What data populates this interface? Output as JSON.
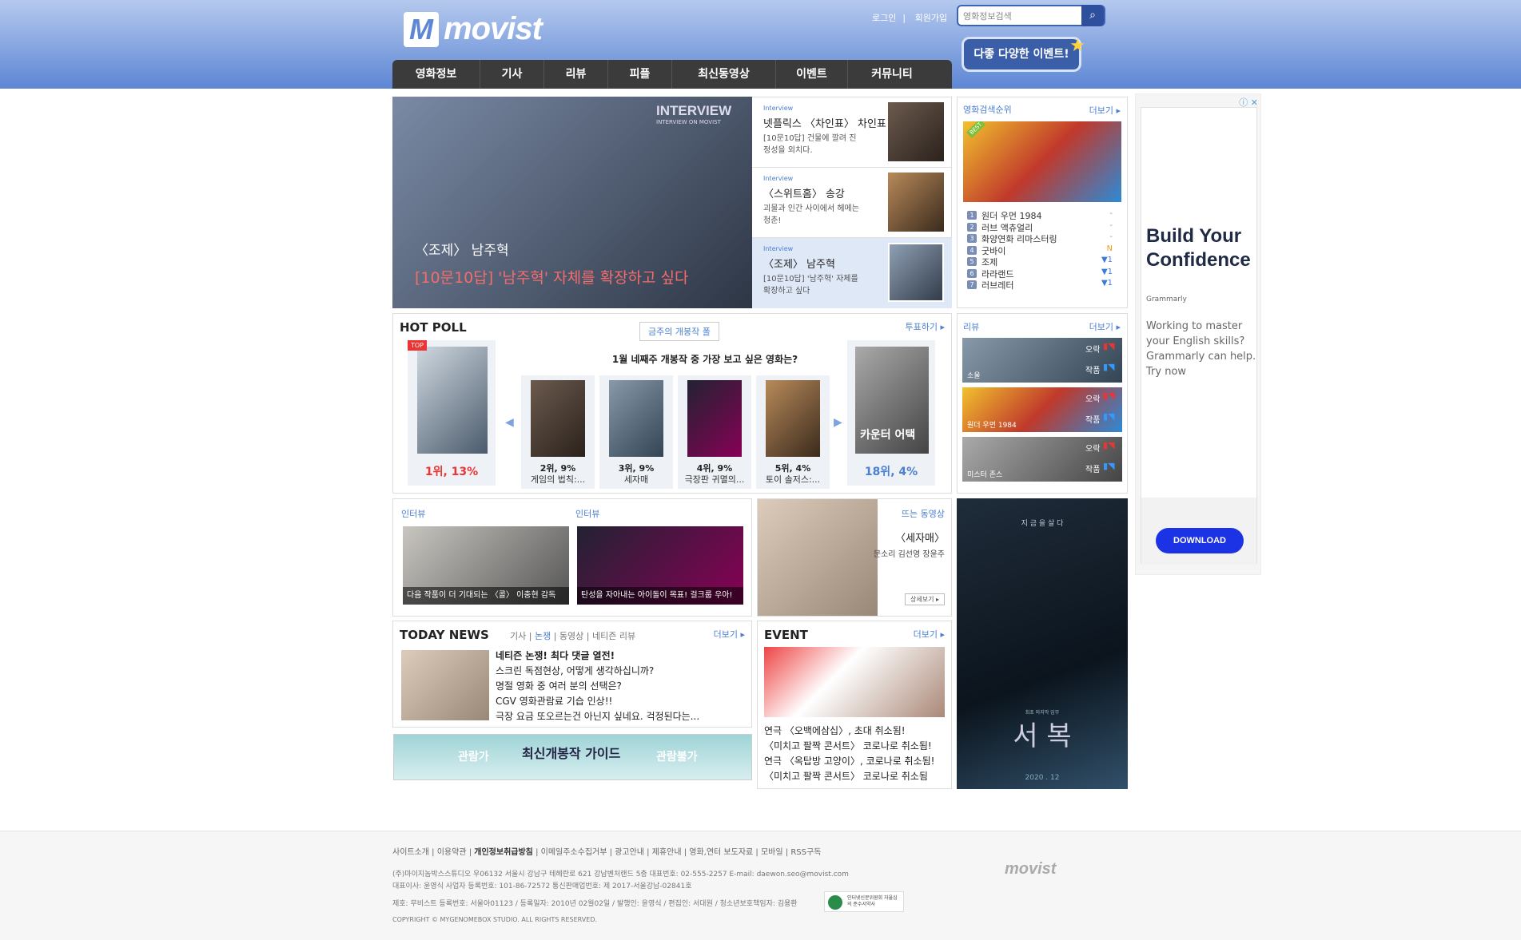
{
  "header": {
    "logo_mark": "M",
    "logo_text": "movist",
    "login": "로그인",
    "signup": "회원가입",
    "search_placeholder": "영화정보검색",
    "event_banner": "다좋 다양한 이벤트!"
  },
  "nav": [
    "영화정보",
    "기사",
    "리뷰",
    "피플",
    "최신동영상",
    "이벤트",
    "커뮤니티"
  ],
  "hero": {
    "badge": "INTERVIEW",
    "badge_sub": "INTERVIEW ON MOVIST",
    "title": "〈조제〉 남주혁",
    "subtitle": "[10문10답] '남주혁' 자체를 확장하고 싶다"
  },
  "interviews": [
    {
      "tag": "Interview",
      "title": "넷플릭스 〈차인표〉 차인표",
      "desc": "[10문10답] 건물에 깔려 진정성을 외치다."
    },
    {
      "tag": "Interview",
      "title": "〈스위트홈〉 송강",
      "desc": "괴물과 인간 사이에서 헤메는 청춘!"
    },
    {
      "tag": "Interview",
      "title": "〈조제〉 남주혁",
      "desc": "[10문10답] '남주혁' 자체를 확장하고 싶다"
    }
  ],
  "ranking": {
    "title": "영화검색순위",
    "more": "더보기",
    "best": "BEST",
    "items": [
      {
        "n": "1",
        "title": "원더 우먼 1984",
        "chg": "-"
      },
      {
        "n": "2",
        "title": "러브 액츄얼리",
        "chg": "-"
      },
      {
        "n": "3",
        "title": "화양연화 리마스터링",
        "chg": "-"
      },
      {
        "n": "4",
        "title": "굿바이",
        "chg": "N"
      },
      {
        "n": "5",
        "title": "조제",
        "chg": "▼1"
      },
      {
        "n": "6",
        "title": "라라랜드",
        "chg": "▼1"
      },
      {
        "n": "7",
        "title": "러브레터",
        "chg": "▼1"
      }
    ]
  },
  "poll": {
    "title": "HOT POLL",
    "vote": "투표하기",
    "tab": "금주의 개봉작 폴",
    "question": "1월 네째주 개봉작 중 가장 보고 싶은 영화는?",
    "first": {
      "rank": "1위, 13%",
      "badge": "TOP"
    },
    "last": {
      "rank": "18위, 4%",
      "poster": "카운터 어택"
    },
    "items": [
      {
        "rank": "2위, 9%",
        "title": "게임의 법칙:..."
      },
      {
        "rank": "3위, 9%",
        "title": "세자매"
      },
      {
        "rank": "4위, 9%",
        "title": "극장판 귀멸의..."
      },
      {
        "rank": "5위, 4%",
        "title": "토이 솔저스:..."
      }
    ]
  },
  "reviews": {
    "title": "리뷰",
    "more": "더보기",
    "ok": "오락",
    "work": "작품",
    "items": [
      {
        "name": "소울"
      },
      {
        "name": "원더 우먼 1984"
      },
      {
        "name": "미스터 존스"
      }
    ]
  },
  "ad": {
    "headline": "Build Your Confidence",
    "brand": "Grammarly",
    "body": "Working to master your English skills? Grammarly can help. Try now",
    "cta": "DOWNLOAD"
  },
  "mid": {
    "int1": {
      "tag": "인터뷰",
      "caption": "다음 작품이 더 기대되는 〈콜〉 이충현 감독"
    },
    "int2": {
      "tag": "인터뷰",
      "caption": "탄성을 자아내는 아이돌이 목표! 걸크룹 우아!"
    },
    "video": {
      "tag": "뜨는 동영상",
      "title": "〈세자매〉",
      "desc": "문소리 김선영 장윤주",
      "detail": "상세보기"
    }
  },
  "poster_right": {
    "top": "지 금 을  살 다",
    "title": "서  복",
    "sub": "최초 마지막 임무",
    "year": "2020 . 12"
  },
  "news": {
    "title": "TODAY NEWS",
    "tabs": [
      "기사",
      "논쟁",
      "동영상",
      "네티즌 리뷰"
    ],
    "more": "더보기",
    "items": [
      "네티즌 논쟁! 최다 댓글 열전!",
      "스크린 독점현상, 어떻게 생각하십니까?",
      "명절 영화 중 여러 분의 선택은?",
      "CGV 영화관람료 기습 인상!!",
      "극장 요금 또오르는건 아닌지 싶네요. 걱정된다는..."
    ]
  },
  "event": {
    "title": "EVENT",
    "more": "더보기",
    "items": [
      "연극 〈오백에삼십〉, 초대 취소됨!",
      "〈미치고 팔짝 콘서트〉 코로나로 취소됨!",
      "연극 〈옥탑방 고양이〉, 코로나로 취소됨!",
      "〈미치고 팔짝 콘서트〉 코로나로 취소됨"
    ]
  },
  "guide": {
    "left": "관람가",
    "title": "최신개봉작 가이드",
    "right": "관람불가"
  },
  "footer": {
    "links": [
      "사이트소개",
      "이용약관",
      "개인정보취급방침",
      "이메일주소수집거부",
      "광고안내",
      "제휴안내",
      "영화,연터 보도자료",
      "모바일",
      "RSS구독"
    ],
    "line1": "(주)마이지놈박스스튜디오  우06132 서울시 강남구 테헤란로 621 강남벤처랜드 5층   대표번호: 02-555-2257   E-mail: daewon.seo@movist.com",
    "line2": "대표이사: 윤영식   사업자 등록번호: 101-86-72572   통신판매업번호: 제 2017-서울강남-02841호",
    "line3": "제호: 무비스트  등록번호: 서울아01123 / 등록일자: 2010년 02월02일 / 발행인: 윤영식 / 편집인: 서대원 / 청소년보호책임자: 김용환",
    "copyright": "COPYRIGHT © MYGENOMEBOX STUDIO. ALL RIGHTS RESERVED.",
    "logo": "movist",
    "badge": "인터넷신문위원회 자율심의 준수서약사"
  }
}
